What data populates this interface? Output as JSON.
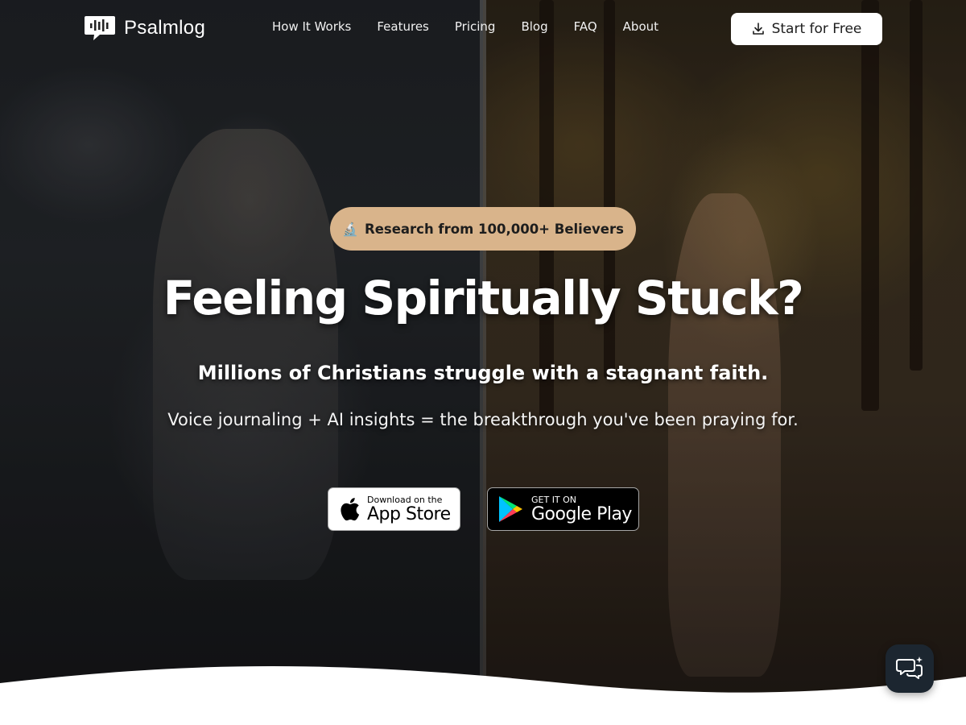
{
  "brand": {
    "name": "Psalmlog"
  },
  "nav": {
    "links": [
      "How It Works",
      "Features",
      "Pricing",
      "Blog",
      "FAQ",
      "About"
    ],
    "cta_label": "Start for Free"
  },
  "hero": {
    "badge_emoji": "🔬",
    "badge_text": "Research from 100,000+ Believers",
    "headline": "Feeling Spiritually Stuck?",
    "subheadline": "Millions of Christians struggle with a stagnant faith.",
    "tagline": "Voice journaling + AI insights = the breakthrough you've been praying for."
  },
  "stores": {
    "app_store": {
      "small": "Download on the",
      "big": "App Store"
    },
    "google_play": {
      "small": "GET IT ON",
      "big": "Google Play"
    }
  },
  "colors": {
    "badge_bg": "#d9b48b",
    "chat_bg": "#1c2630",
    "cta_bg": "#ffffff"
  },
  "icons": {
    "cta": "download-icon",
    "chat": "chat-bubbles-icon",
    "logo": "sound-wave-bubble-icon"
  }
}
